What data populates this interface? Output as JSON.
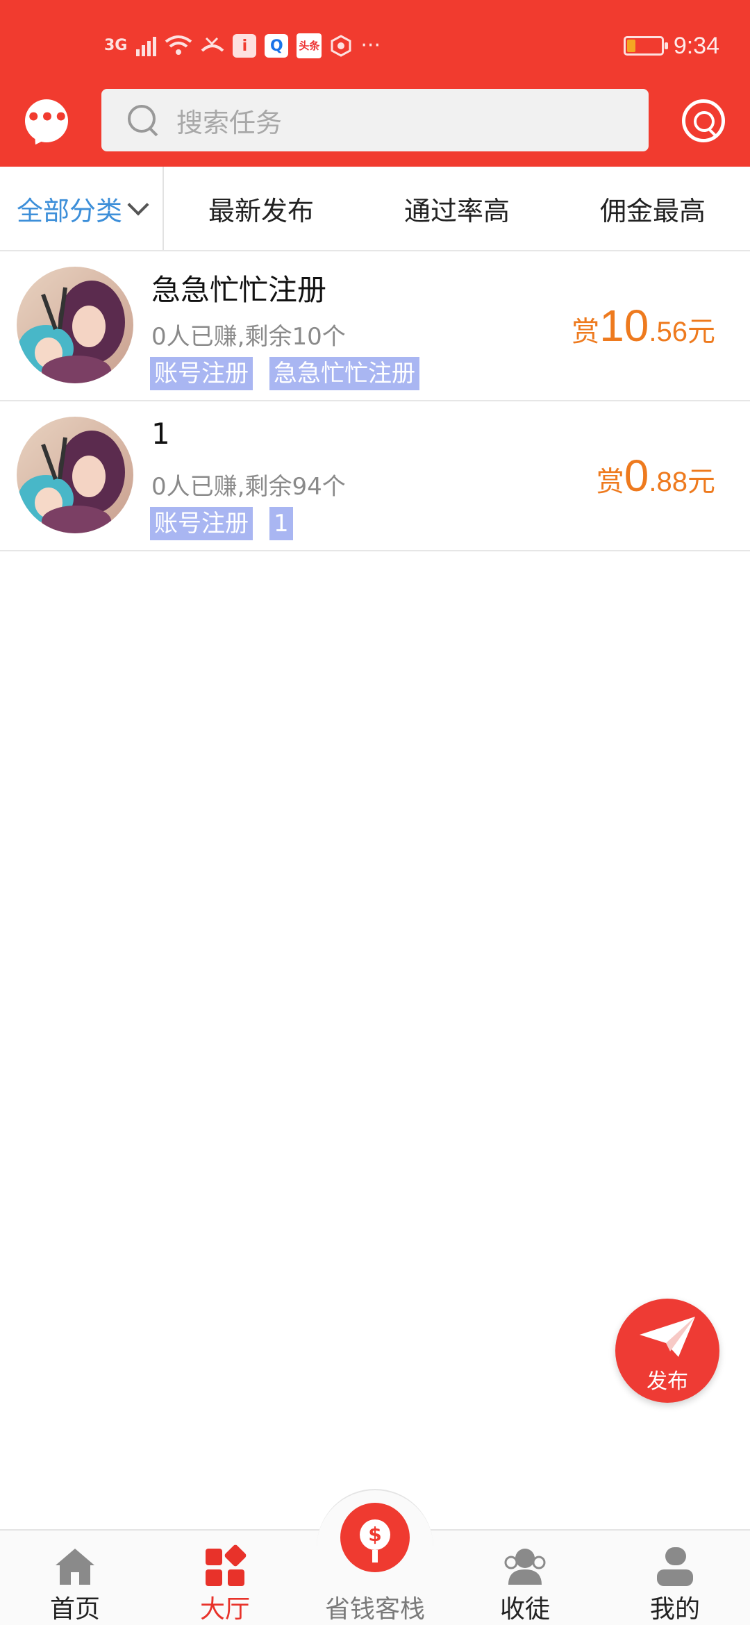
{
  "status_bar": {
    "time": "9:34",
    "icons": [
      "signal-3g-icon",
      "wifi-icon",
      "missed-call-icon",
      "info-app-icon",
      "browser-app-icon",
      "toutiao-app-icon",
      "shield-app-icon",
      "more-dots-icon",
      "battery-icon"
    ],
    "signal_label": "3G",
    "news_badge": "头条"
  },
  "header": {
    "search_placeholder": "搜索任务"
  },
  "filters": {
    "category": "全部分类",
    "tabs": [
      "最新发布",
      "通过率高",
      "佣金最高"
    ]
  },
  "tasks": [
    {
      "title": "急急忙忙注册",
      "meta": "0人已赚,剩余10个",
      "tags": [
        "账号注册",
        "急急忙忙注册"
      ],
      "reward_prefix": "赏",
      "reward_int": "10",
      "reward_dec": ".56",
      "reward_unit": "元"
    },
    {
      "title": "1",
      "meta": "0人已赚,剩余94个",
      "tags": [
        "账号注册",
        "1"
      ],
      "reward_prefix": "赏",
      "reward_int": "0",
      "reward_dec": ".88",
      "reward_unit": "元"
    }
  ],
  "fab": {
    "label": "发布"
  },
  "bottom_nav": [
    {
      "label": "首页",
      "icon": "home-icon"
    },
    {
      "label": "大厅",
      "icon": "hall-grid-icon",
      "active": true
    },
    {
      "label": "省钱客栈",
      "icon": "money-lantern-icon"
    },
    {
      "label": "收徒",
      "icon": "users-icon"
    },
    {
      "label": "我的",
      "icon": "profile-icon"
    }
  ],
  "colors": {
    "brand_red": "#f13b2f",
    "reward_orange": "#ee7a1e",
    "tag_blue": "#a9b6f2",
    "category_blue": "#3d8fd9"
  }
}
